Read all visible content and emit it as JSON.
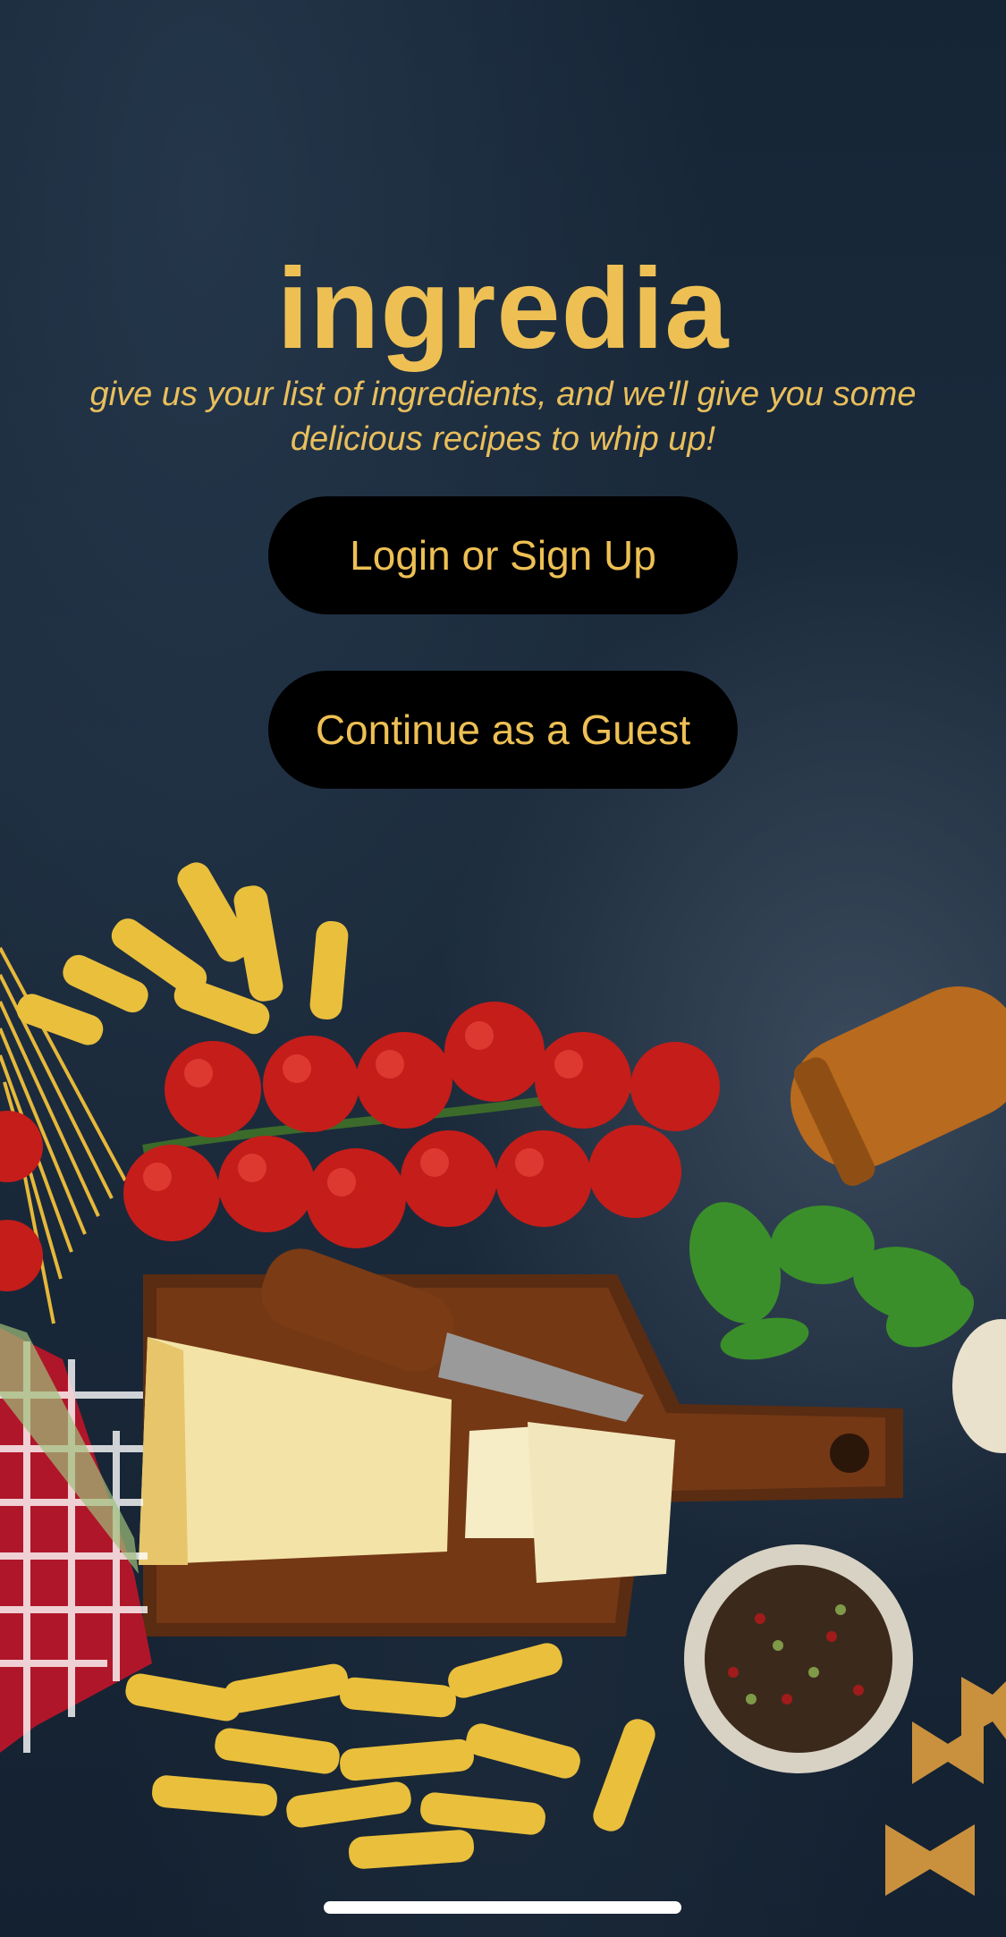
{
  "app": {
    "title": "ingredia",
    "tagline": "give us your list of ingredients, and we'll give you some delicious recipes to whip up!"
  },
  "actions": {
    "login_label": "Login or Sign Up",
    "guest_label": "Continue as a Guest"
  },
  "colors": {
    "accent": "#eec054",
    "button_bg": "#000000",
    "background": "#162536"
  }
}
